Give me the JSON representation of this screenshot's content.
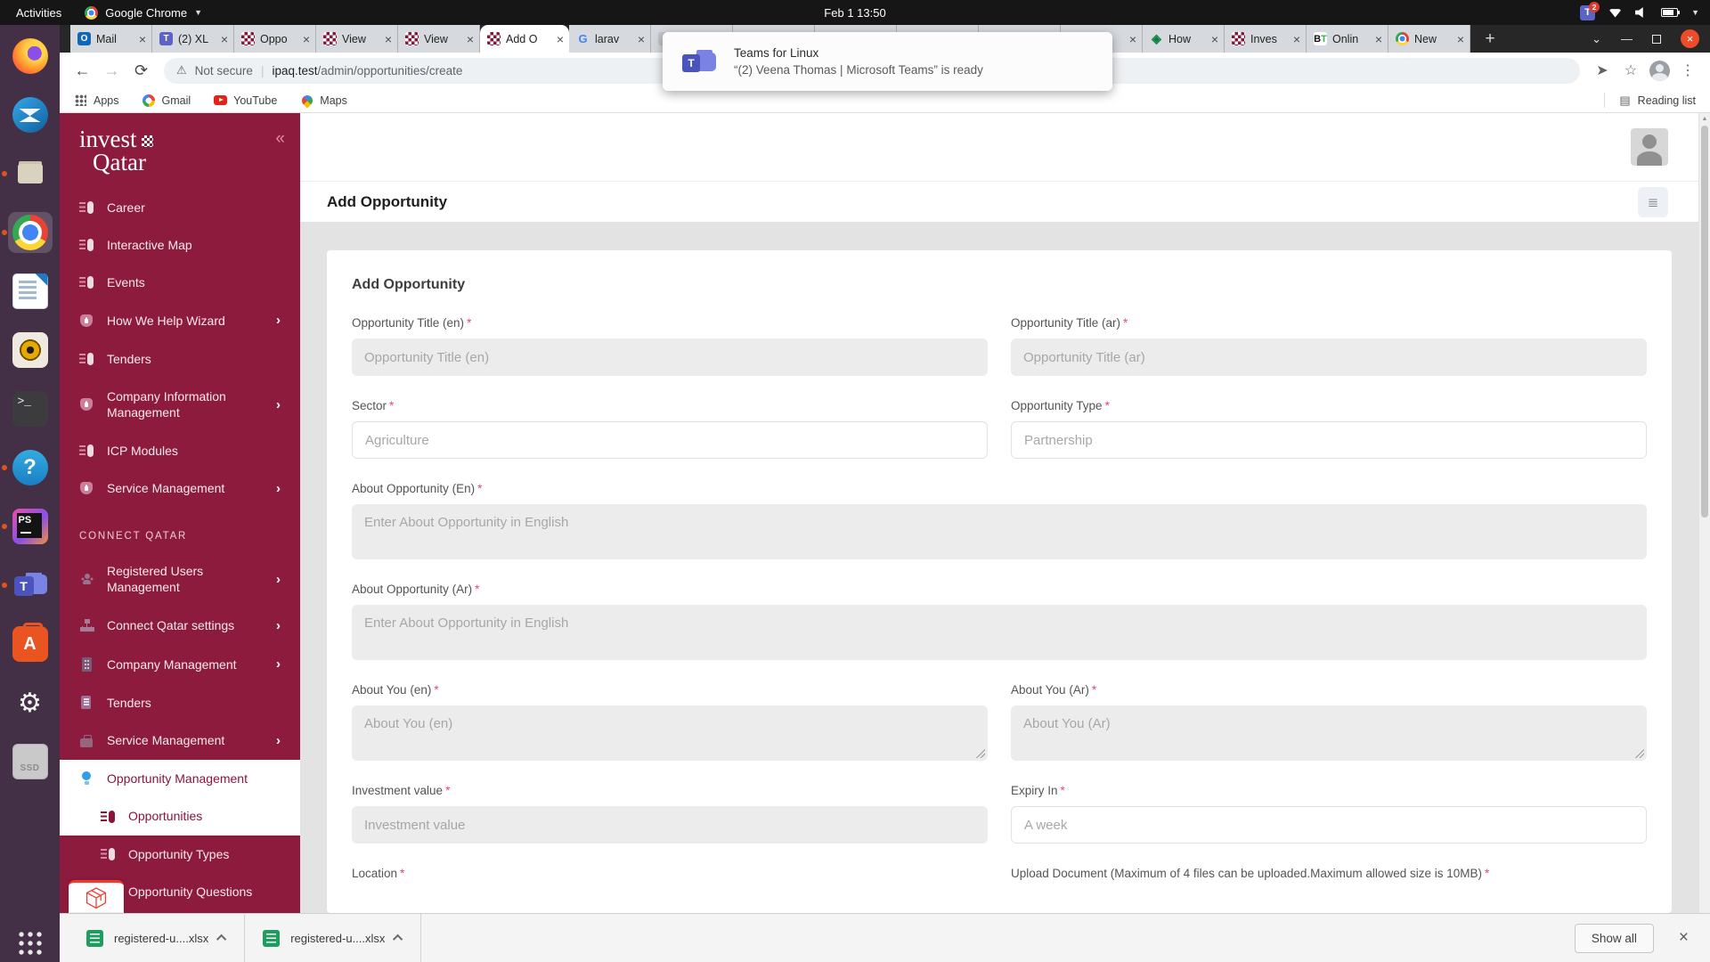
{
  "system_bar": {
    "activities_label": "Activities",
    "app_menu_label": "Google Chrome",
    "clock": "Feb 1 13:50",
    "teams_badge": "2"
  },
  "notification": {
    "app_title": "Teams for Linux",
    "message": "“(2) Veena Thomas | Microsoft Teams” is ready"
  },
  "browser": {
    "tabs": [
      {
        "icon": "outlook",
        "label": "Mail",
        "active": false
      },
      {
        "icon": "teams",
        "label": "(2) XL",
        "active": false
      },
      {
        "icon": "iq",
        "label": "Oppo",
        "active": false
      },
      {
        "icon": "iq",
        "label": "View",
        "active": false
      },
      {
        "icon": "iq",
        "label": "View",
        "active": false
      },
      {
        "icon": "iq",
        "label": "Add O",
        "active": true
      },
      {
        "icon": "google",
        "label": "larav",
        "active": false
      },
      {
        "icon": "blank",
        "label": "",
        "active": false
      },
      {
        "icon": "blank",
        "label": "",
        "active": false
      },
      {
        "icon": "blank",
        "label": "",
        "active": false
      },
      {
        "icon": "blank",
        "label": "",
        "active": false
      },
      {
        "icon": "blank",
        "label": "",
        "active": false
      },
      {
        "icon": "blank",
        "label": "",
        "active": false
      },
      {
        "icon": "diamond",
        "label": "How",
        "active": false
      },
      {
        "icon": "iq",
        "label": "Inves",
        "active": false
      },
      {
        "icon": "bt",
        "label": "Onlin",
        "active": false
      },
      {
        "icon": "chrome",
        "label": "New",
        "active": false
      }
    ],
    "new_tab_label": "+",
    "toolbar": {
      "security_label": "Not secure",
      "url_host": "ipaq.test",
      "url_path": "/admin/opportunities/create"
    },
    "bookmarks": [
      {
        "icon": "apps",
        "label": "Apps"
      },
      {
        "icon": "gmail",
        "label": "Gmail"
      },
      {
        "icon": "yt",
        "label": "YouTube"
      },
      {
        "icon": "maps",
        "label": "Maps"
      }
    ],
    "reading_list_label": "Reading list"
  },
  "dock": {
    "items": [
      {
        "name": "firefox",
        "running": false,
        "active": false
      },
      {
        "name": "thunderbird",
        "running": false,
        "active": false
      },
      {
        "name": "files",
        "running": true,
        "active": false
      },
      {
        "name": "chrome",
        "running": true,
        "active": true
      },
      {
        "name": "writer",
        "running": false,
        "active": false
      },
      {
        "name": "rhythmbox",
        "running": false,
        "active": false
      },
      {
        "name": "terminal",
        "running": false,
        "active": false
      },
      {
        "name": "help",
        "running": true,
        "active": false
      },
      {
        "name": "phpstorm",
        "running": true,
        "active": false
      },
      {
        "name": "teams",
        "running": true,
        "active": false
      },
      {
        "name": "software",
        "running": false,
        "active": false
      },
      {
        "name": "settings",
        "running": false,
        "active": false
      },
      {
        "name": "ssd",
        "running": false,
        "active": false
      }
    ]
  },
  "sidebar": {
    "logo_line1": "invest",
    "logo_line2": "Qatar",
    "collapse_glyph": "«",
    "items": [
      {
        "type": "item",
        "icon": "flag",
        "label": "Career",
        "chevron": false,
        "white": false,
        "indent": false
      },
      {
        "type": "item",
        "icon": "flag",
        "label": "Interactive Map",
        "chevron": false,
        "white": false,
        "indent": false
      },
      {
        "type": "item",
        "icon": "flag",
        "label": "Events",
        "chevron": false,
        "white": false,
        "indent": false
      },
      {
        "type": "item",
        "icon": "shield",
        "label": "How We Help Wizard",
        "chevron": true,
        "white": false,
        "indent": false
      },
      {
        "type": "item",
        "icon": "flag",
        "label": "Tenders",
        "chevron": false,
        "white": false,
        "indent": false
      },
      {
        "type": "item",
        "icon": "shield",
        "label": "Company Information Management",
        "chevron": true,
        "white": false,
        "indent": false
      },
      {
        "type": "item",
        "icon": "flag",
        "label": "ICP Modules",
        "chevron": false,
        "white": false,
        "indent": false
      },
      {
        "type": "item",
        "icon": "shield",
        "label": "Service Management",
        "chevron": true,
        "white": false,
        "indent": false
      },
      {
        "type": "section",
        "label": "CONNECT QATAR"
      },
      {
        "type": "item",
        "icon": "users",
        "label": "Registered Users Management",
        "chevron": true,
        "white": false,
        "indent": false
      },
      {
        "type": "item",
        "icon": "sitemap",
        "label": "Connect Qatar settings",
        "chevron": true,
        "white": false,
        "indent": false
      },
      {
        "type": "item",
        "icon": "building",
        "label": "Company Management",
        "chevron": true,
        "white": false,
        "indent": false
      },
      {
        "type": "item",
        "icon": "doc",
        "label": "Tenders",
        "chevron": false,
        "white": false,
        "indent": false
      },
      {
        "type": "item",
        "icon": "briefcase",
        "label": "Service Management",
        "chevron": true,
        "white": false,
        "indent": false
      },
      {
        "type": "item",
        "icon": "bulb",
        "label": "Opportunity Management",
        "chevron": false,
        "white": true,
        "indent": false
      },
      {
        "type": "item",
        "icon": "flag",
        "label": "Opportunities",
        "chevron": false,
        "white": true,
        "indent": true
      },
      {
        "type": "item",
        "icon": "flag",
        "label": "Opportunity Types",
        "chevron": false,
        "white": false,
        "indent": true
      },
      {
        "type": "item",
        "icon": "flag",
        "label": "Opportunity Questions",
        "chevron": false,
        "white": false,
        "indent": true
      }
    ]
  },
  "page": {
    "header_title": "Add Opportunity",
    "card_title": "Add Opportunity",
    "form_fields": [
      {
        "label": "Opportunity Title (en)",
        "required": true,
        "control": "input",
        "variant": "gray",
        "placeholder": "Opportunity Title (en)",
        "full": false,
        "resize": false
      },
      {
        "label": "Opportunity Title (ar)",
        "required": true,
        "control": "input",
        "variant": "gray",
        "placeholder": "Opportunity Title (ar)",
        "full": false,
        "resize": false
      },
      {
        "label": "Sector",
        "required": true,
        "control": "input",
        "variant": "white",
        "placeholder": "Agriculture",
        "full": false,
        "resize": false
      },
      {
        "label": "Opportunity Type",
        "required": true,
        "control": "input",
        "variant": "white",
        "placeholder": "Partnership",
        "full": false,
        "resize": false
      },
      {
        "label": "About Opportunity (En)",
        "required": true,
        "control": "textarea",
        "variant": "gray",
        "placeholder": "Enter About Opportunity  in English",
        "full": true,
        "resize": true
      },
      {
        "label": "About Opportunity (Ar)",
        "required": true,
        "control": "textarea",
        "variant": "gray",
        "placeholder": "Enter About Opportunity  in English",
        "full": true,
        "resize": true
      },
      {
        "label": "About You (en)",
        "required": true,
        "control": "textarea",
        "variant": "gray",
        "placeholder": "About You (en)",
        "full": false,
        "resize": true
      },
      {
        "label": "About You (Ar)",
        "required": true,
        "control": "textarea",
        "variant": "gray",
        "placeholder": "About You (Ar)",
        "full": false,
        "resize": true
      },
      {
        "label": "Investment value",
        "required": true,
        "control": "input",
        "variant": "gray",
        "placeholder": "Investment value",
        "full": false,
        "resize": false
      },
      {
        "label": "Expiry In",
        "required": true,
        "control": "input",
        "variant": "white",
        "placeholder": "A week",
        "full": false,
        "resize": false
      },
      {
        "label": "Location",
        "required": true,
        "control": "none",
        "variant": "",
        "placeholder": "",
        "full": false,
        "resize": false
      },
      {
        "label": "Upload Document (Maximum of 4 files can be uploaded.Maximum allowed size is 10MB)",
        "required": true,
        "control": "none",
        "variant": "",
        "placeholder": "",
        "full": false,
        "resize": false
      }
    ]
  },
  "downloads": {
    "items": [
      {
        "name": "registered-u....xlsx"
      },
      {
        "name": "registered-u....xlsx"
      }
    ],
    "show_all_label": "Show all"
  },
  "colors": {
    "brand_maroon": "#8A1538",
    "sidebar_bg": "#8d1b3d",
    "ubuntu_orange": "#e95420",
    "required_asterisk": "#e8476b",
    "xlsx_green": "#1d9e5f"
  }
}
